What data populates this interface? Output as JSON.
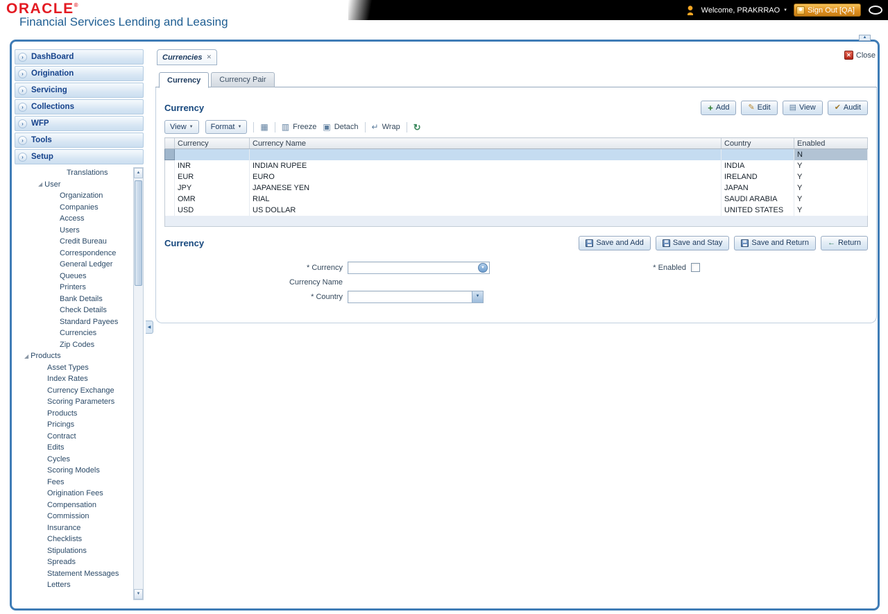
{
  "colors": {
    "brand_red": "#e31b23",
    "title_blue": "#1f5e92",
    "nav_text": "#15428b",
    "frame_blue": "#3f7cb6",
    "selected_row": "#c5dcf1",
    "signout_orange": "#df8f1f",
    "link_navy": "#1c3a5e"
  },
  "icons": {
    "chevron_right": "›",
    "caret_down": "▼",
    "tab_close": "✕",
    "close_x": "✕",
    "add": "+",
    "edit": "✎",
    "view": "▤",
    "audit": "✔",
    "export": "▦",
    "freeze": "▥",
    "detach": "▣",
    "wrap": "↵",
    "refresh": "↻",
    "return": "←",
    "expand": "◢",
    "scroll_up": "▲",
    "scroll_down": "▼",
    "collapse_left": "◀",
    "collapse_up": "▲"
  },
  "header": {
    "logo": "ORACLE",
    "logo_reg": "®",
    "app_title": "Financial Services Lending and Leasing",
    "welcome": "Welcome, PRAKRRAO",
    "sign_out": "Sign Out [QA]"
  },
  "close_panel": {
    "label": "Close"
  },
  "sidebar": {
    "nav": [
      "DashBoard",
      "Origination",
      "Servicing",
      "Collections",
      "WFP",
      "Tools",
      "Setup"
    ],
    "tree": [
      {
        "label": "Translations",
        "level": 4,
        "expandable": false
      },
      {
        "label": "User",
        "level": 2,
        "expandable": true
      },
      {
        "label": "Organization",
        "level": 3,
        "expandable": false
      },
      {
        "label": "Companies",
        "level": 3,
        "expandable": false
      },
      {
        "label": "Access",
        "level": 3,
        "expandable": false
      },
      {
        "label": "Users",
        "level": 3,
        "expandable": false
      },
      {
        "label": "Credit Bureau",
        "level": 3,
        "expandable": false
      },
      {
        "label": "Correspondence",
        "level": 3,
        "expandable": false
      },
      {
        "label": "General Ledger",
        "level": 3,
        "expandable": false
      },
      {
        "label": "Queues",
        "level": 3,
        "expandable": false
      },
      {
        "label": "Printers",
        "level": 3,
        "expandable": false
      },
      {
        "label": "Bank Details",
        "level": 3,
        "expandable": false
      },
      {
        "label": "Check Details",
        "level": 3,
        "expandable": false
      },
      {
        "label": "Standard Payees",
        "level": 3,
        "expandable": false
      },
      {
        "label": "Currencies",
        "level": 3,
        "expandable": false
      },
      {
        "label": "Zip Codes",
        "level": 3,
        "expandable": false
      },
      {
        "label": "Products",
        "level": 1,
        "expandable": true
      },
      {
        "label": "Asset Types",
        "level": 2,
        "expandable": false
      },
      {
        "label": "Index Rates",
        "level": 2,
        "expandable": false
      },
      {
        "label": "Currency Exchange",
        "level": 2,
        "expandable": false
      },
      {
        "label": "Scoring Parameters",
        "level": 2,
        "expandable": false
      },
      {
        "label": "Products",
        "level": 2,
        "expandable": false
      },
      {
        "label": "Pricings",
        "level": 2,
        "expandable": false
      },
      {
        "label": "Contract",
        "level": 2,
        "expandable": false
      },
      {
        "label": "Edits",
        "level": 2,
        "expandable": false
      },
      {
        "label": "Cycles",
        "level": 2,
        "expandable": false
      },
      {
        "label": "Scoring Models",
        "level": 2,
        "expandable": false
      },
      {
        "label": "Fees",
        "level": 2,
        "expandable": false
      },
      {
        "label": "Origination Fees",
        "level": 2,
        "expandable": false
      },
      {
        "label": "Compensation",
        "level": 2,
        "expandable": false
      },
      {
        "label": "Commission",
        "level": 2,
        "expandable": false
      },
      {
        "label": "Insurance",
        "level": 2,
        "expandable": false
      },
      {
        "label": "Checklists",
        "level": 2,
        "expandable": false
      },
      {
        "label": "Stipulations",
        "level": 2,
        "expandable": false
      },
      {
        "label": "Spreads",
        "level": 2,
        "expandable": false
      },
      {
        "label": "Statement Messages",
        "level": 2,
        "expandable": false
      },
      {
        "label": "Letters",
        "level": 2,
        "expandable": false
      }
    ]
  },
  "workspace": {
    "doc_tab": {
      "label": "Currencies"
    },
    "subtabs": [
      {
        "label": "Currency",
        "active": true
      },
      {
        "label": "Currency Pair",
        "active": false
      }
    ],
    "grid_section": {
      "title": "Currency",
      "actions": [
        {
          "label": "Add",
          "icon": "add"
        },
        {
          "label": "Edit",
          "icon": "edit"
        },
        {
          "label": "View",
          "icon": "view"
        },
        {
          "label": "Audit",
          "icon": "audit"
        }
      ],
      "toolbar": {
        "view": "View",
        "format": "Format",
        "freeze": "Freeze",
        "detach": "Detach",
        "wrap": "Wrap"
      },
      "table": {
        "columns": [
          "Currency",
          "Currency Name",
          "Country",
          "Enabled"
        ],
        "rows": [
          {
            "currency": "",
            "name": "",
            "country": "",
            "enabled": "N",
            "selected": true
          },
          {
            "currency": "INR",
            "name": "INDIAN RUPEE",
            "country": "INDIA",
            "enabled": "Y"
          },
          {
            "currency": "EUR",
            "name": "EURO",
            "country": "IRELAND",
            "enabled": "Y"
          },
          {
            "currency": "JPY",
            "name": "JAPANESE YEN",
            "country": "JAPAN",
            "enabled": "Y"
          },
          {
            "currency": "OMR",
            "name": "RIAL",
            "country": "SAUDI ARABIA",
            "enabled": "Y"
          },
          {
            "currency": "USD",
            "name": "US DOLLAR",
            "country": "UNITED STATES",
            "enabled": "Y"
          }
        ]
      }
    },
    "form_section": {
      "title": "Currency",
      "buttons": [
        {
          "label": "Save and Add",
          "icon": "save"
        },
        {
          "label": "Save and Stay",
          "icon": "save"
        },
        {
          "label": "Save and Return",
          "icon": "save"
        },
        {
          "label": "Return",
          "icon": "return"
        }
      ],
      "fields": {
        "currency_label": "* Currency",
        "currency_name_label": "Currency Name",
        "country_label": "* Country",
        "enabled_label": "* Enabled"
      }
    }
  }
}
